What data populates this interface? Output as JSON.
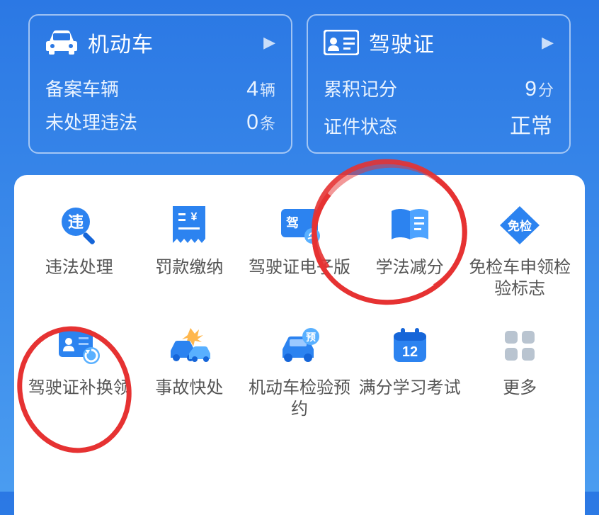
{
  "cards": {
    "vehicle": {
      "title": "机动车",
      "rows": [
        {
          "label": "备案车辆",
          "value": "4",
          "unit": "辆"
        },
        {
          "label": "未处理违法",
          "value": "0",
          "unit": "条"
        }
      ]
    },
    "license": {
      "title": "驾驶证",
      "rows": [
        {
          "label": "累积记分",
          "value": "9",
          "unit": "分"
        },
        {
          "label": "证件状态",
          "value": "正常",
          "unit": ""
        }
      ]
    }
  },
  "grid": [
    {
      "label": "违法处理"
    },
    {
      "label": "罚款缴纳"
    },
    {
      "label": "驾驶证电子版"
    },
    {
      "label": "学法减分"
    },
    {
      "label": "免检车申领检验标志"
    },
    {
      "label": "驾驶证补换领"
    },
    {
      "label": "事故快处"
    },
    {
      "label": "机动车检验预约"
    },
    {
      "label": "满分学习考试"
    },
    {
      "label": "更多"
    }
  ],
  "badges": {
    "wei": "违",
    "jia": "驾",
    "mianjian": "免检",
    "yu": "预",
    "twelve": "12"
  }
}
